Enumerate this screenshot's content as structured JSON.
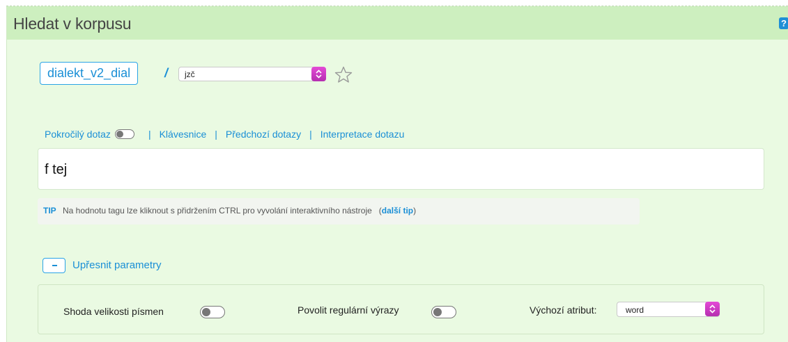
{
  "header": {
    "title": "Hledat v korpusu",
    "help_glyph": "?"
  },
  "corpus": {
    "name": "dialekt_v2_dial",
    "separator": "/",
    "subcorpus_value": "jzč"
  },
  "query_links": {
    "advanced": "Pokročilý dotaz",
    "keyboard": "Klávesnice",
    "history": "Předchozí dotazy",
    "interpretation": "Interpretace dotazu",
    "separator": "|"
  },
  "query": {
    "value": "f tej"
  },
  "tip": {
    "label": "TIP",
    "text": "Na hodnotu tagu lze kliknout s přidržením CTRL pro vyvolání interaktivního nástroje",
    "open_paren": "(",
    "next_link": "další tip",
    "close_paren": ")"
  },
  "refine": {
    "button_glyph": "-",
    "label": "Upřesnit parametry"
  },
  "options": {
    "case_match": "Shoda velikosti písmen",
    "regex": "Povolit regulární výrazy",
    "default_attr_label": "Výchozí atribut:",
    "default_attr_value": "word"
  },
  "colors": {
    "accent": "#1a8fd6",
    "panel_bg": "#eafae2",
    "header_bg": "#cdefbf",
    "select_arrow": "#c83cc4"
  }
}
